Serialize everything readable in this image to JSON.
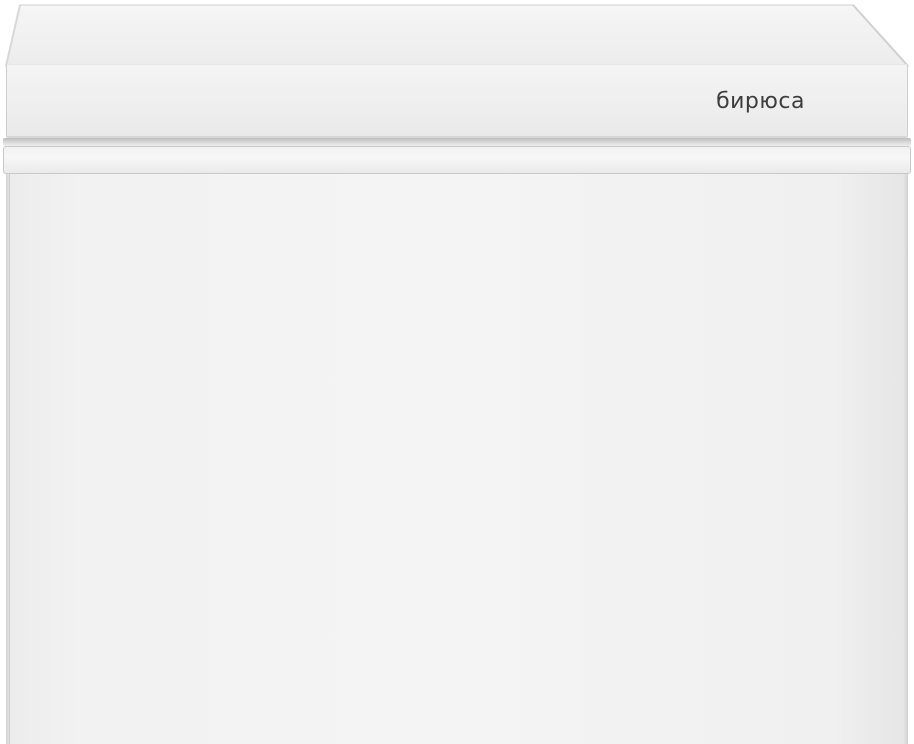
{
  "product": {
    "brand_logo": "бирюса"
  },
  "colors": {
    "cabinet": "#f2f2f2",
    "lid": "#eeeeee",
    "outline": "#c9c9c9",
    "logo": "#3d3d3d"
  }
}
